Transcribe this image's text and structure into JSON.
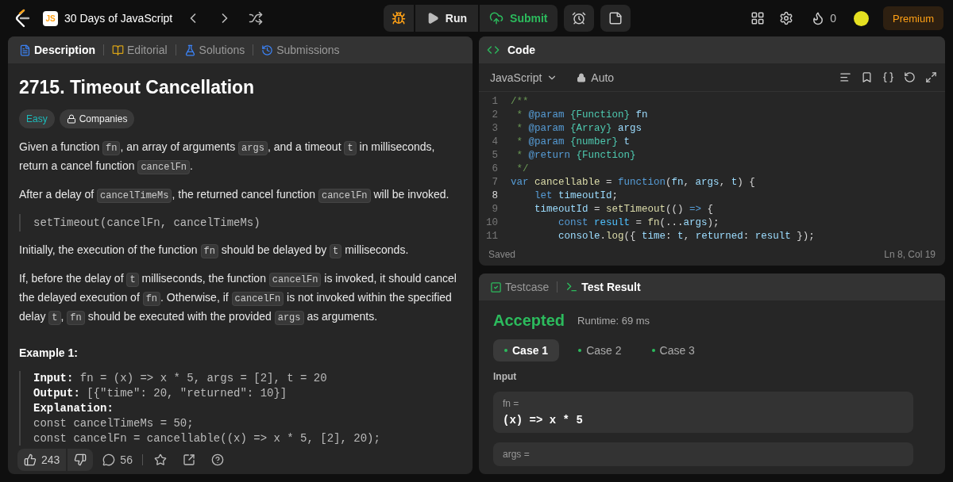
{
  "topbar": {
    "badge": "JS",
    "study_plan": "30 Days of JavaScript",
    "run": "Run",
    "submit": "Submit",
    "streak": "0",
    "premium": "Premium"
  },
  "description_tabs": [
    {
      "label": "Description",
      "selected": true
    },
    {
      "label": "Editorial",
      "selected": false
    },
    {
      "label": "Solutions",
      "selected": false
    },
    {
      "label": "Submissions",
      "selected": false
    }
  ],
  "problem": {
    "title": "2715. Timeout Cancellation",
    "difficulty": "Easy",
    "companies": "Companies",
    "blocks": [
      {
        "kind": "paragraph",
        "parts": [
          {
            "kind": "text",
            "text": "Given a function "
          },
          {
            "kind": "code",
            "text": "fn"
          },
          {
            "kind": "text",
            "text": ", an array of arguments "
          },
          {
            "kind": "code",
            "text": "args"
          },
          {
            "kind": "text",
            "text": ", and a timeout "
          },
          {
            "kind": "code",
            "text": "t"
          },
          {
            "kind": "text",
            "text": " in milliseconds, return a cancel function "
          },
          {
            "kind": "code",
            "text": "cancelFn"
          },
          {
            "kind": "text",
            "text": "."
          }
        ]
      },
      {
        "kind": "paragraph",
        "parts": [
          {
            "kind": "text",
            "text": "After a delay of "
          },
          {
            "kind": "code",
            "text": "cancelTimeMs"
          },
          {
            "kind": "text",
            "text": ", the returned cancel function "
          },
          {
            "kind": "code",
            "text": "cancelFn"
          },
          {
            "kind": "text",
            "text": " will be invoked."
          }
        ]
      },
      {
        "kind": "quote",
        "text": "setTimeout(cancelFn, cancelTimeMs)"
      },
      {
        "kind": "paragraph",
        "parts": [
          {
            "kind": "text",
            "text": "Initially, the execution of the function "
          },
          {
            "kind": "code",
            "text": "fn"
          },
          {
            "kind": "text",
            "text": " should be delayed by "
          },
          {
            "kind": "code",
            "text": "t"
          },
          {
            "kind": "text",
            "text": " milliseconds."
          }
        ]
      },
      {
        "kind": "paragraph",
        "parts": [
          {
            "kind": "text",
            "text": "If, before the delay of "
          },
          {
            "kind": "code",
            "text": "t"
          },
          {
            "kind": "text",
            "text": " milliseconds, the function "
          },
          {
            "kind": "code",
            "text": "cancelFn"
          },
          {
            "kind": "text",
            "text": " is invoked, it should cancel the delayed execution of "
          },
          {
            "kind": "code",
            "text": "fn"
          },
          {
            "kind": "text",
            "text": ". Otherwise, if "
          },
          {
            "kind": "code",
            "text": "cancelFn"
          },
          {
            "kind": "text",
            "text": " is not invoked within the specified delay "
          },
          {
            "kind": "code",
            "text": "t"
          },
          {
            "kind": "text",
            "text": ", "
          },
          {
            "kind": "code",
            "text": "fn"
          },
          {
            "kind": "text",
            "text": " should be executed with the provided "
          },
          {
            "kind": "code",
            "text": "args"
          },
          {
            "kind": "text",
            "text": " as arguments."
          }
        ]
      },
      {
        "kind": "heading",
        "text": "Example 1:"
      },
      {
        "kind": "example",
        "lines": [
          "**Input:** fn = (x) => x * 5, args = [2], t = 20",
          "**Output:** [{\"time\": 20, \"returned\": 10}]",
          "**Explanation:**",
          "const cancelTimeMs = 50;",
          "const cancelFn = cancellable((x) => x * 5, [2], 20);"
        ]
      }
    ]
  },
  "footer": {
    "likes": "243",
    "comments": "56"
  },
  "code_panel": {
    "title": "Code",
    "language": "JavaScript",
    "mode": "Auto",
    "status": "Saved",
    "cursor": "Ln 8, Col 19",
    "lines": [
      {
        "number": "1",
        "current": false,
        "tokens": [
          {
            "kind": "comment",
            "text": "/**"
          }
        ]
      },
      {
        "number": "2",
        "current": false,
        "tokens": [
          {
            "kind": "comment",
            "text": " * "
          },
          {
            "kind": "tag",
            "text": "@param"
          },
          {
            "kind": "type",
            "text": " {Function}"
          },
          {
            "kind": "variable",
            "text": " fn"
          }
        ]
      },
      {
        "number": "3",
        "current": false,
        "tokens": [
          {
            "kind": "comment",
            "text": " * "
          },
          {
            "kind": "tag",
            "text": "@param"
          },
          {
            "kind": "type",
            "text": " {Array}"
          },
          {
            "kind": "variable",
            "text": " args"
          }
        ]
      },
      {
        "number": "4",
        "current": false,
        "tokens": [
          {
            "kind": "comment",
            "text": " * "
          },
          {
            "kind": "tag",
            "text": "@param"
          },
          {
            "kind": "type",
            "text": " {number}"
          },
          {
            "kind": "variable",
            "text": " t"
          }
        ]
      },
      {
        "number": "5",
        "current": false,
        "tokens": [
          {
            "kind": "comment",
            "text": " * "
          },
          {
            "kind": "tag",
            "text": "@return"
          },
          {
            "kind": "type",
            "text": " {Function}"
          }
        ]
      },
      {
        "number": "6",
        "current": false,
        "tokens": [
          {
            "kind": "comment",
            "text": " */"
          }
        ]
      },
      {
        "number": "7",
        "current": false,
        "tokens": [
          {
            "kind": "keyword",
            "text": "var"
          },
          {
            "kind": "function",
            "text": " cancellable"
          },
          {
            "kind": "plain",
            "text": " = "
          },
          {
            "kind": "keyword",
            "text": "function"
          },
          {
            "kind": "plain",
            "text": "("
          },
          {
            "kind": "variable",
            "text": "fn"
          },
          {
            "kind": "plain",
            "text": ", "
          },
          {
            "kind": "variable",
            "text": "args"
          },
          {
            "kind": "plain",
            "text": ", "
          },
          {
            "kind": "variable",
            "text": "t"
          },
          {
            "kind": "plain",
            "text": ") {"
          }
        ]
      },
      {
        "number": "8",
        "current": true,
        "tokens": [
          {
            "kind": "keyword",
            "text": "    let"
          },
          {
            "kind": "variable",
            "text": " timeoutId"
          },
          {
            "kind": "plain",
            "text": ";"
          }
        ]
      },
      {
        "number": "9",
        "current": false,
        "tokens": [
          {
            "kind": "variable",
            "text": "    timeoutId"
          },
          {
            "kind": "plain",
            "text": " = "
          },
          {
            "kind": "function",
            "text": "setTimeout"
          },
          {
            "kind": "plain",
            "text": "(() "
          },
          {
            "kind": "keyword",
            "text": "=>"
          },
          {
            "kind": "plain",
            "text": " {"
          }
        ]
      },
      {
        "number": "10",
        "current": false,
        "tokens": [
          {
            "kind": "keyword",
            "text": "        const"
          },
          {
            "kind": "constant",
            "text": " result"
          },
          {
            "kind": "plain",
            "text": " = "
          },
          {
            "kind": "function",
            "text": "fn"
          },
          {
            "kind": "plain",
            "text": "(..."
          },
          {
            "kind": "variable",
            "text": "args"
          },
          {
            "kind": "plain",
            "text": ");"
          }
        ]
      },
      {
        "number": "11",
        "current": false,
        "tokens": [
          {
            "kind": "variable",
            "text": "        console"
          },
          {
            "kind": "plain",
            "text": "."
          },
          {
            "kind": "function",
            "text": "log"
          },
          {
            "kind": "plain",
            "text": "({ "
          },
          {
            "kind": "variable",
            "text": "time"
          },
          {
            "kind": "plain",
            "text": ": "
          },
          {
            "kind": "variable",
            "text": "t"
          },
          {
            "kind": "plain",
            "text": ", "
          },
          {
            "kind": "variable",
            "text": "returned"
          },
          {
            "kind": "plain",
            "text": ": "
          },
          {
            "kind": "variable",
            "text": "result"
          },
          {
            "kind": "plain",
            "text": " });"
          }
        ]
      }
    ]
  },
  "result_panel": {
    "tabs": [
      {
        "label": "Testcase",
        "selected": false
      },
      {
        "label": "Test Result",
        "selected": true
      }
    ],
    "verdict": "Accepted",
    "runtime": "Runtime: 69 ms",
    "cases": [
      {
        "label": "Case 1",
        "selected": true,
        "passed": true
      },
      {
        "label": "Case 2",
        "selected": false,
        "passed": true
      },
      {
        "label": "Case 3",
        "selected": false,
        "passed": true
      }
    ],
    "input_label": "Input",
    "inputs": [
      {
        "name": "fn =",
        "value": "(x) => x * 5"
      },
      {
        "name": "args ="
      }
    ]
  }
}
